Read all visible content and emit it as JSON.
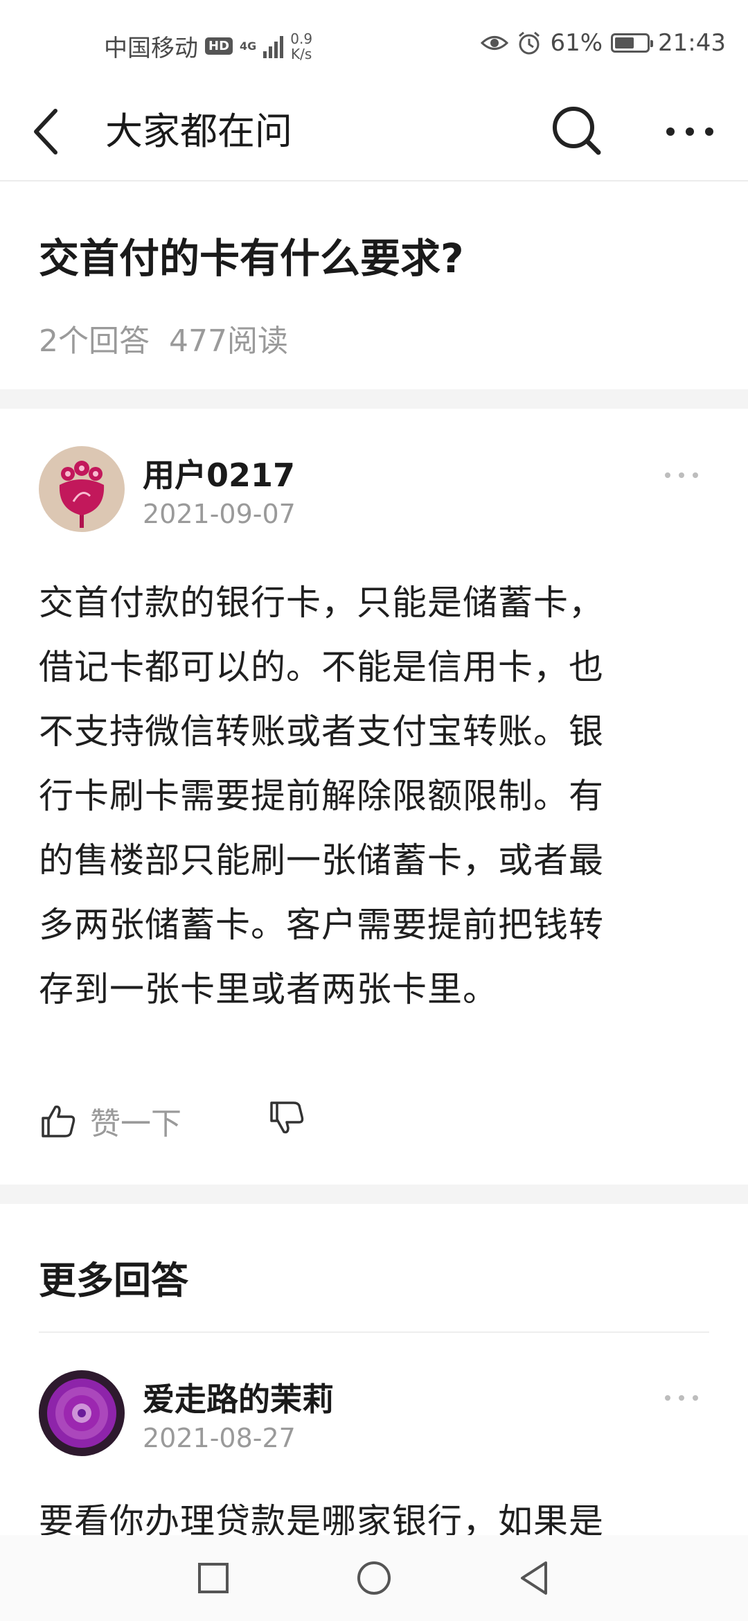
{
  "status_bar": {
    "carrier": "中国移动",
    "hd_badge": "HD",
    "network": "4G",
    "speed_value": "0.9",
    "speed_unit": "K/s",
    "battery_percent": "61%",
    "battery_level": 0.61,
    "time": "21:43"
  },
  "header": {
    "title": "大家都在问"
  },
  "question": {
    "title": "交首付的卡有什么要求?",
    "answer_count": "2个回答",
    "read_count": "477阅读"
  },
  "answers": [
    {
      "author": "用户0217",
      "date": "2021-09-07",
      "lines": [
        "交首付款的银行卡，只能是储蓄卡，",
        "借记卡都可以的。不能是信用卡，也",
        "不支持微信转账或者支付宝转账。银",
        "行卡刷卡需要提前解除限额限制。有",
        "的售楼部只能刷一张储蓄卡，或者最",
        "多两张储蓄卡。客户需要提前把钱转",
        "存到一张卡里或者两张卡里。"
      ],
      "like_label": "赞一下"
    },
    {
      "author": "爱走路的茉莉",
      "date": "2021-08-27",
      "lines": [
        "要看你办理贷款是哪家银行，如果是"
      ]
    }
  ],
  "more_answers_title": "更多回答",
  "colors": {
    "text_primary": "#1a1a1a",
    "text_secondary": "#9a9a9a",
    "band": "#f4f4f4"
  }
}
